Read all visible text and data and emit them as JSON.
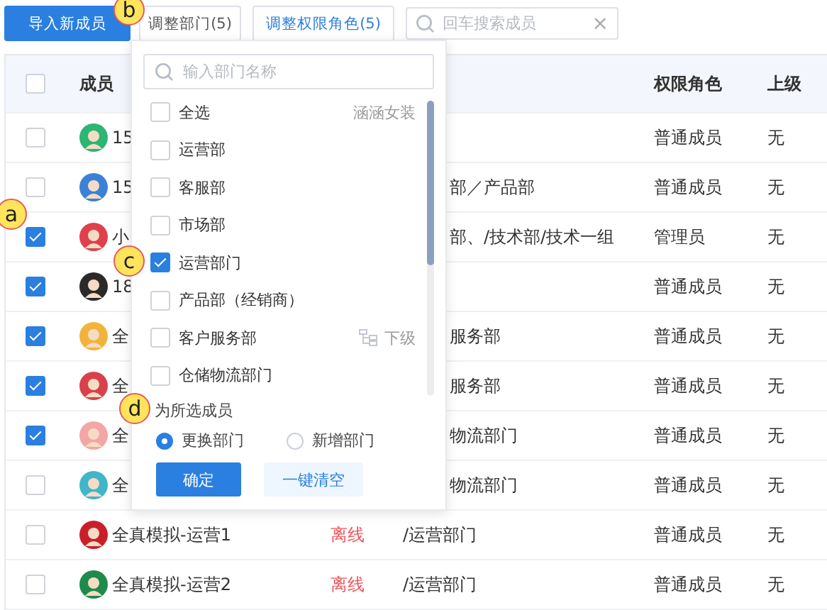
{
  "toolbar": {
    "import_button": "导入新成员",
    "adjust_department_button": "调整部门(5)",
    "adjust_role_button": "调整权限角色(5)",
    "search": {
      "placeholder": "回车搜索成员",
      "clear": "×"
    }
  },
  "table": {
    "header_checkbox": {
      "checked": false
    },
    "columns": [
      {
        "label": "成员"
      },
      {
        "label": "权限角色"
      },
      {
        "label": "上级"
      }
    ],
    "rows": [
      {
        "checked": false,
        "member": "15",
        "color": "#2bb673",
        "role": "普通成员",
        "superior": "无"
      },
      {
        "checked": false,
        "member": "15",
        "color": "#3b82d6",
        "department": "部／产品部",
        "role": "普通成员",
        "superior": "无"
      },
      {
        "checked": true,
        "member": "小",
        "color": "#e0404a",
        "department": "部、/技术部/技术一组",
        "role": "管理员",
        "superior": "无"
      },
      {
        "checked": true,
        "member": "18",
        "color": "#2a2a2a",
        "role": "普通成员",
        "superior": "无"
      },
      {
        "checked": true,
        "member": "全",
        "color": "#f2b33d",
        "department": "服务部",
        "role": "普通成员",
        "superior": "无"
      },
      {
        "checked": true,
        "member": "全",
        "color": "#d8414b",
        "department": "服务部",
        "role": "普通成员",
        "superior": "无"
      },
      {
        "checked": true,
        "member": "全",
        "color": "#f3a6a6",
        "department": "物流部门",
        "role": "普通成员",
        "superior": "无"
      },
      {
        "checked": false,
        "member": "全",
        "color": "#41b5c9",
        "department": "物流部门",
        "role": "普通成员",
        "superior": "无"
      },
      {
        "checked": false,
        "member": "全真模拟-运营1",
        "color": "#c8202a",
        "status": "离线",
        "department": "/运营部门",
        "role": "普通成员",
        "superior": "无"
      },
      {
        "checked": false,
        "member": "全真模拟-运营2",
        "color": "#1e8a4c",
        "status": "离线",
        "department": "/运营部门",
        "role": "普通成员",
        "superior": "无"
      }
    ]
  },
  "popover": {
    "search": {
      "placeholder": "输入部门名称"
    },
    "items": [
      {
        "label": "全选",
        "checked": false,
        "note": "涵涵女装"
      },
      {
        "label": "运营部",
        "checked": false
      },
      {
        "label": "客服部",
        "checked": false
      },
      {
        "label": "市场部",
        "checked": false
      },
      {
        "label": "运营部门",
        "checked": true
      },
      {
        "label": "产品部（经销商）",
        "checked": false
      },
      {
        "label": "客户服务部",
        "checked": false,
        "sub_link": "下级"
      },
      {
        "label": "仓储物流部门",
        "checked": false
      }
    ],
    "apply_label": "为所选成员",
    "modes": [
      {
        "label": "更换部门",
        "selected": true
      },
      {
        "label": "新增部门",
        "selected": false
      }
    ],
    "confirm_button": "确定",
    "clear_button": "一键清空"
  },
  "callouts": [
    {
      "label": "a"
    },
    {
      "label": "b"
    },
    {
      "label": "c"
    },
    {
      "label": "d"
    }
  ]
}
